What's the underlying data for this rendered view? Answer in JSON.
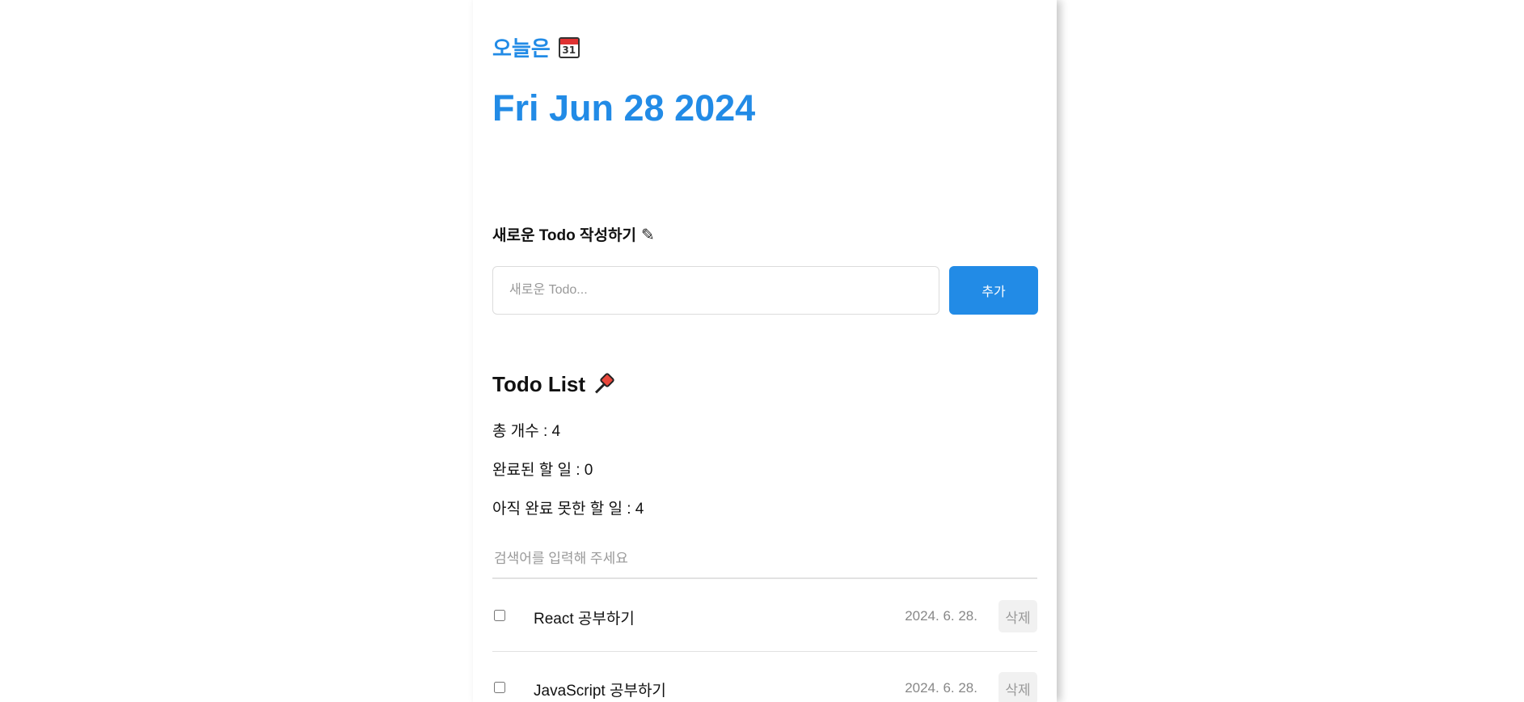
{
  "header": {
    "today_label": "오늘은",
    "calendar_day": "31",
    "date": "Fri Jun 28 2024"
  },
  "editor": {
    "title": "새로운 Todo 작성하기",
    "input_value": "",
    "input_placeholder": "새로운 Todo...",
    "add_label": "추가"
  },
  "list": {
    "title": "Todo List",
    "total_text": "총 개수 : 4",
    "done_text": "완료된 할 일 : 0",
    "undone_text": "아직 완료 못한 할 일 : 4",
    "search_value": "",
    "search_placeholder": "검색어를 입력해 주세요",
    "items": [
      {
        "content": "React 공부하기",
        "date": "2024. 6. 28.",
        "delete_label": "삭제",
        "done": false
      },
      {
        "content": "JavaScript 공부하기",
        "date": "2024. 6. 28.",
        "delete_label": "삭제",
        "done": false
      }
    ]
  },
  "colors": {
    "accent": "#228be6",
    "divider": "#e2e2e2",
    "muted_text": "#888888"
  }
}
